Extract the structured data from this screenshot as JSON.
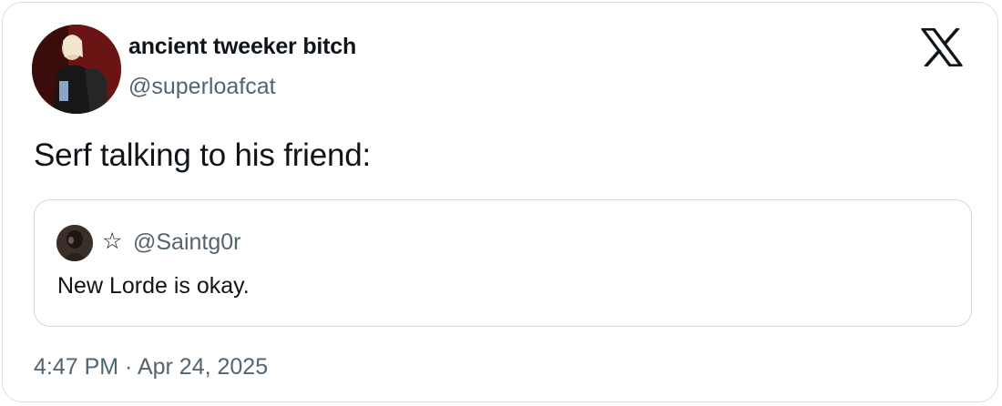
{
  "tweet": {
    "author": {
      "display_name": "ancient tweeker bitch",
      "handle": "@superloafcat",
      "avatar_icon": "profile-photo"
    },
    "platform_icon": "x-logo-icon",
    "text": "Serf talking to his friend:",
    "quoted": {
      "avatar_icon": "profile-photo",
      "name_symbol": "☆",
      "handle": "@Saintg0r",
      "text": "New Lorde is okay."
    },
    "timestamp": "4:47 PM · Apr 24, 2025"
  },
  "colors": {
    "primary_text": "#0f1419",
    "secondary_text": "#536471",
    "border": "#cfd9de"
  }
}
